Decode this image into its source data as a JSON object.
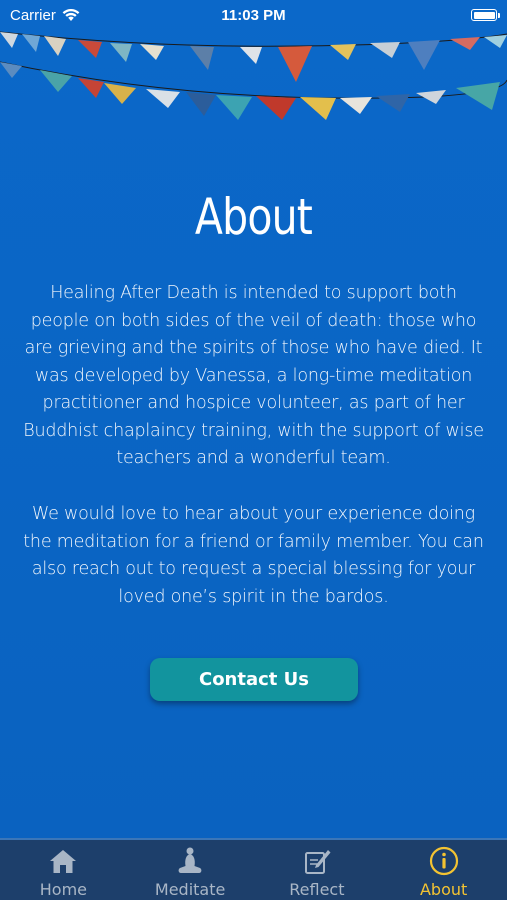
{
  "status_bar": {
    "carrier": "Carrier",
    "time": "11:03 PM"
  },
  "page": {
    "title": "About",
    "paragraphs": [
      "Healing After Death is intended to support both people on both sides of the veil of death: those who are grieving and the spirits of those who have died. It was developed by Vanessa, a long-time meditation practitioner and hospice volunteer, as part of her Buddhist chaplaincy training, with the support of wise teachers and a wonderful team.",
      "We would love to hear about your experience doing the meditation for a friend or family member. You can also reach out to request a special blessing for your loved one’s spirit in the bardos."
    ],
    "contact_button": "Contact Us"
  },
  "tab_bar": {
    "items": [
      {
        "label": "Home",
        "icon": "home-icon",
        "active": false
      },
      {
        "label": "Meditate",
        "icon": "meditate-icon",
        "active": false
      },
      {
        "label": "Reflect",
        "icon": "reflect-icon",
        "active": false
      },
      {
        "label": "About",
        "icon": "info-icon",
        "active": true
      }
    ]
  },
  "colors": {
    "background": "#0a66c6",
    "button": "#12949e",
    "tab_bar": "#1d3f6b",
    "tab_active": "#f3c332",
    "tab_inactive": "#a9b6c6"
  }
}
